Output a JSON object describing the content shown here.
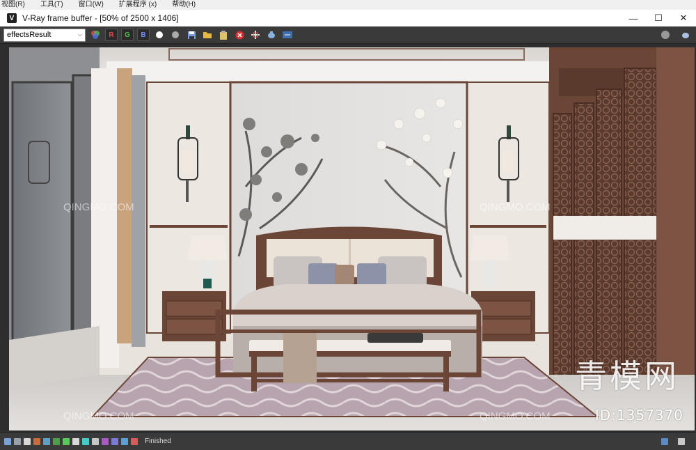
{
  "host_menu": [
    "视图(R)",
    "工具(T)",
    "窗口(W)",
    "扩展程序 (x)",
    "帮助(H)"
  ],
  "window": {
    "icon_letter": "V",
    "title": "V-Ray frame buffer - [50% of 2500 x 1406]",
    "minimize": "—",
    "maximize": "☐",
    "close": "✕"
  },
  "toolbar": {
    "channel_value": "effectsResult",
    "chevron": "⌵",
    "r_label": "R",
    "g_label": "G",
    "b_label": "B"
  },
  "status": {
    "text": "Finished"
  },
  "watermarks": {
    "repeat": "QINGMO.COM",
    "big": "青模网",
    "id": "ID:1357370"
  },
  "colors": {
    "titlebar": "#ffffff",
    "toolbar": "#3a3a3a",
    "wall": "#e9e3dd",
    "wood": "#6b4536",
    "rug": "#b9a6b1"
  }
}
